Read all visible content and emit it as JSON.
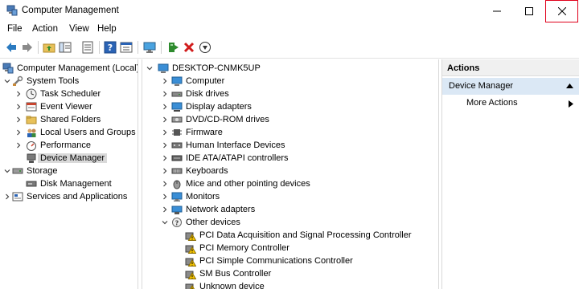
{
  "window": {
    "title": "Computer Management"
  },
  "menu": {
    "items": [
      "File",
      "Action",
      "View",
      "Help"
    ]
  },
  "toolbar": {
    "buttons": [
      "back-icon",
      "forward-icon",
      "up-folder-icon",
      "show-hide-tree-icon",
      "properties-icon",
      "help-icon",
      "console-icon",
      "update-driver-icon",
      "uninstall-icon",
      "scan-hardware-icon"
    ]
  },
  "left_tree": {
    "root": "Computer Management (Local)",
    "system_tools": "System Tools",
    "task_scheduler": "Task Scheduler",
    "event_viewer": "Event Viewer",
    "shared_folders": "Shared Folders",
    "local_users_groups": "Local Users and Groups",
    "performance": "Performance",
    "device_manager": "Device Manager",
    "storage": "Storage",
    "disk_management": "Disk Management",
    "services_apps": "Services and Applications"
  },
  "device_tree": {
    "host": "DESKTOP-CNMK5UP",
    "categories": [
      "Computer",
      "Disk drives",
      "Display adapters",
      "DVD/CD-ROM drives",
      "Firmware",
      "Human Interface Devices",
      "IDE ATA/ATAPI controllers",
      "Keyboards",
      "Mice and other pointing devices",
      "Monitors",
      "Network adapters",
      "Other devices"
    ],
    "other_devices": [
      "PCI Data Acquisition and Signal Processing Controller",
      "PCI Memory Controller",
      "PCI Simple Communications Controller",
      "SM Bus Controller",
      "Unknown device"
    ]
  },
  "actions": {
    "header": "Actions",
    "section": "Device Manager",
    "more": "More Actions"
  },
  "colors": {
    "close_outline": "#e0001b",
    "selected_bg": "#d9d9d9",
    "actions_section_bg": "#dbe8f5",
    "warning_yellow": "#f5c400"
  }
}
